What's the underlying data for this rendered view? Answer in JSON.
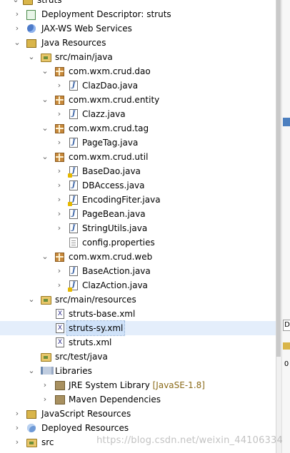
{
  "tree": [
    {
      "label": "struts",
      "icon": "project-icon",
      "expanded": true
    },
    {
      "label": "Deployment Descriptor: struts",
      "icon": "deployment-descriptor-icon",
      "expanded": false
    },
    {
      "label": "JAX-WS Web Services",
      "icon": "web-services-icon",
      "expanded": false
    },
    {
      "label": "Java Resources",
      "icon": "java-resources-icon",
      "expanded": true
    },
    {
      "label": "src/main/java",
      "icon": "source-folder-icon",
      "expanded": true
    },
    {
      "label": "com.wxm.crud.dao",
      "icon": "package-icon",
      "expanded": true
    },
    {
      "label": "ClazDao.java",
      "icon": "java-file-icon",
      "expanded": false
    },
    {
      "label": "com.wxm.crud.entity",
      "icon": "package-icon",
      "expanded": true
    },
    {
      "label": "Clazz.java",
      "icon": "java-file-icon",
      "expanded": false
    },
    {
      "label": "com.wxm.crud.tag",
      "icon": "package-icon",
      "expanded": true
    },
    {
      "label": "PageTag.java",
      "icon": "java-file-icon",
      "expanded": false
    },
    {
      "label": "com.wxm.crud.util",
      "icon": "package-icon",
      "expanded": true
    },
    {
      "label": "BaseDao.java",
      "icon": "java-file-icon",
      "expanded": false
    },
    {
      "label": "DBAccess.java",
      "icon": "java-file-icon",
      "expanded": false
    },
    {
      "label": "EncodingFiter.java",
      "icon": "java-file-icon",
      "expanded": false
    },
    {
      "label": "PageBean.java",
      "icon": "java-file-icon",
      "expanded": false
    },
    {
      "label": "StringUtils.java",
      "icon": "java-file-icon",
      "expanded": false
    },
    {
      "label": "config.properties",
      "icon": "properties-file-icon"
    },
    {
      "label": "com.wxm.crud.web",
      "icon": "package-icon",
      "expanded": true
    },
    {
      "label": "BaseAction.java",
      "icon": "java-file-icon",
      "expanded": false
    },
    {
      "label": "ClazAction.java",
      "icon": "java-file-icon",
      "expanded": false
    },
    {
      "label": "src/main/resources",
      "icon": "source-folder-icon",
      "expanded": true
    },
    {
      "label": "struts-base.xml",
      "icon": "xml-file-icon"
    },
    {
      "label": "struts-sy.xml",
      "icon": "xml-file-icon",
      "selected": true
    },
    {
      "label": "struts.xml",
      "icon": "xml-file-icon"
    },
    {
      "label": "src/test/java",
      "icon": "source-folder-icon"
    },
    {
      "label": "Libraries",
      "icon": "libraries-icon",
      "expanded": true
    },
    {
      "label": "JRE System Library",
      "decoration": "[JavaSE-1.8]",
      "icon": "library-icon",
      "expanded": false
    },
    {
      "label": "Maven Dependencies",
      "icon": "library-icon",
      "expanded": false
    },
    {
      "label": "JavaScript Resources",
      "icon": "javascript-resources-icon",
      "expanded": false
    },
    {
      "label": "Deployed Resources",
      "icon": "deployed-resources-icon",
      "expanded": false
    },
    {
      "label": "src",
      "icon": "folder-icon",
      "expanded": false
    }
  ],
  "right_edge": {
    "chars": [
      "D",
      "0"
    ]
  },
  "watermark": "https://blog.csdn.net/weixin_44106334"
}
